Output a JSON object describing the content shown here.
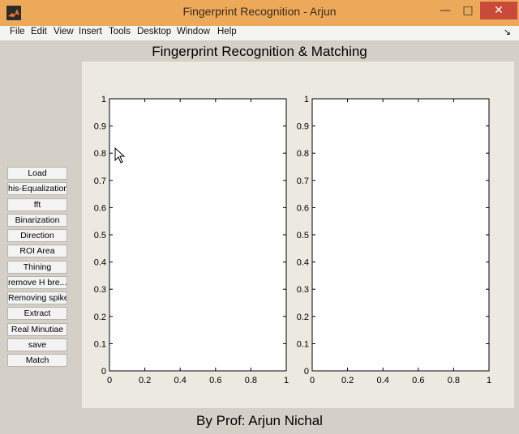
{
  "window": {
    "title": "Fingerprint Recognition - Arjun",
    "minimize_glyph": "—",
    "maximize_glyph": "□",
    "close_glyph": "✕",
    "title_bar_color": "#eda95a"
  },
  "menu": {
    "items": [
      "File",
      "Edit",
      "View",
      "Insert",
      "Tools",
      "Desktop",
      "Window",
      "Help"
    ],
    "dock_arrow": "↘"
  },
  "heading": "Fingerprint Recognition & Matching",
  "footer": "By Prof: Arjun Nichal",
  "buttons": [
    "Load",
    "his-Equalization",
    "fft",
    "Binarization",
    "Direction",
    "ROI Area",
    "Thining",
    "remove H bre...",
    "Removing spike",
    "Extract",
    "Real Minutiae",
    "save",
    "Match"
  ],
  "axes": [
    {
      "xlim": [
        0,
        1
      ],
      "ylim": [
        0,
        1
      ],
      "xticks": [
        "0",
        "0.2",
        "0.4",
        "0.6",
        "0.8",
        "1"
      ],
      "yticks": [
        "0",
        "0.1",
        "0.2",
        "0.3",
        "0.4",
        "0.5",
        "0.6",
        "0.7",
        "0.8",
        "0.9",
        "1"
      ]
    },
    {
      "xlim": [
        0,
        1
      ],
      "ylim": [
        0,
        1
      ],
      "xticks": [
        "0",
        "0.2",
        "0.4",
        "0.6",
        "0.8",
        "1"
      ],
      "yticks": [
        "0",
        "0.1",
        "0.2",
        "0.3",
        "0.4",
        "0.5",
        "0.6",
        "0.7",
        "0.8",
        "0.9",
        "1"
      ]
    }
  ]
}
